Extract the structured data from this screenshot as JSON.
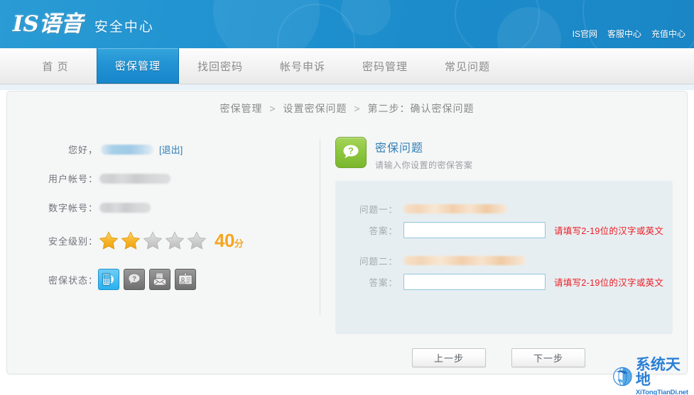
{
  "header": {
    "logo_main": "IS语音",
    "logo_sub": "安全中心",
    "top_links": [
      {
        "label": "IS官网"
      },
      {
        "label": "客服中心"
      },
      {
        "label": "充值中心"
      }
    ]
  },
  "nav": {
    "items": [
      {
        "label": "首 页",
        "active": false
      },
      {
        "label": "密保管理",
        "active": true
      },
      {
        "label": "找回密码",
        "active": false
      },
      {
        "label": "帐号申诉",
        "active": false
      },
      {
        "label": "密码管理",
        "active": false
      },
      {
        "label": "常见问题",
        "active": false
      }
    ]
  },
  "breadcrumb": {
    "items": [
      "密保管理",
      "设置密保问题",
      "第二步：确认密保问题"
    ],
    "separator": ">"
  },
  "user_panel": {
    "greeting_label": "您好，",
    "username_masked": "",
    "logout_label": "[退出]",
    "account_label": "用户帐号：",
    "account_masked": "",
    "number_label": "数字帐号：",
    "number_masked": "",
    "security_level_label": "安全级别：",
    "stars_total": 5,
    "stars_filled": 2,
    "score_value": "40",
    "score_unit": "分",
    "protect_status_label": "密保状态：",
    "status_icons": [
      {
        "name": "phone-icon",
        "active": true
      },
      {
        "name": "question-icon",
        "active": false
      },
      {
        "name": "mail-icon",
        "active": false
      },
      {
        "name": "idcard-icon",
        "active": false
      }
    ]
  },
  "question_section": {
    "title": "密保问题",
    "subtitle": "请输入你设置的密保答案",
    "badge_icon": "question-bubble-icon",
    "rows": [
      {
        "question_label": "问题一：",
        "question_masked": "",
        "answer_label": "答案：",
        "answer_value": "",
        "hint": "请填写2-19位的汉字或英文"
      },
      {
        "question_label": "问题二：",
        "question_masked": "",
        "answer_label": "答案：",
        "answer_value": "",
        "hint": "请填写2-19位的汉字或英文"
      }
    ],
    "prev_button": "上一步",
    "next_button": "下一步"
  },
  "watermark": {
    "cn": "系统天地",
    "en": "XiTongTianDi.net"
  },
  "colors": {
    "header_blue": "#1f92d0",
    "active_tab": "#2293d3",
    "link_blue": "#2a7fb8",
    "title_blue": "#2f7fb5",
    "hint_red": "#ea1c23",
    "star_gold": "#f5a623",
    "badge_green": "#8dc63f",
    "form_bg": "#e7eef1"
  }
}
